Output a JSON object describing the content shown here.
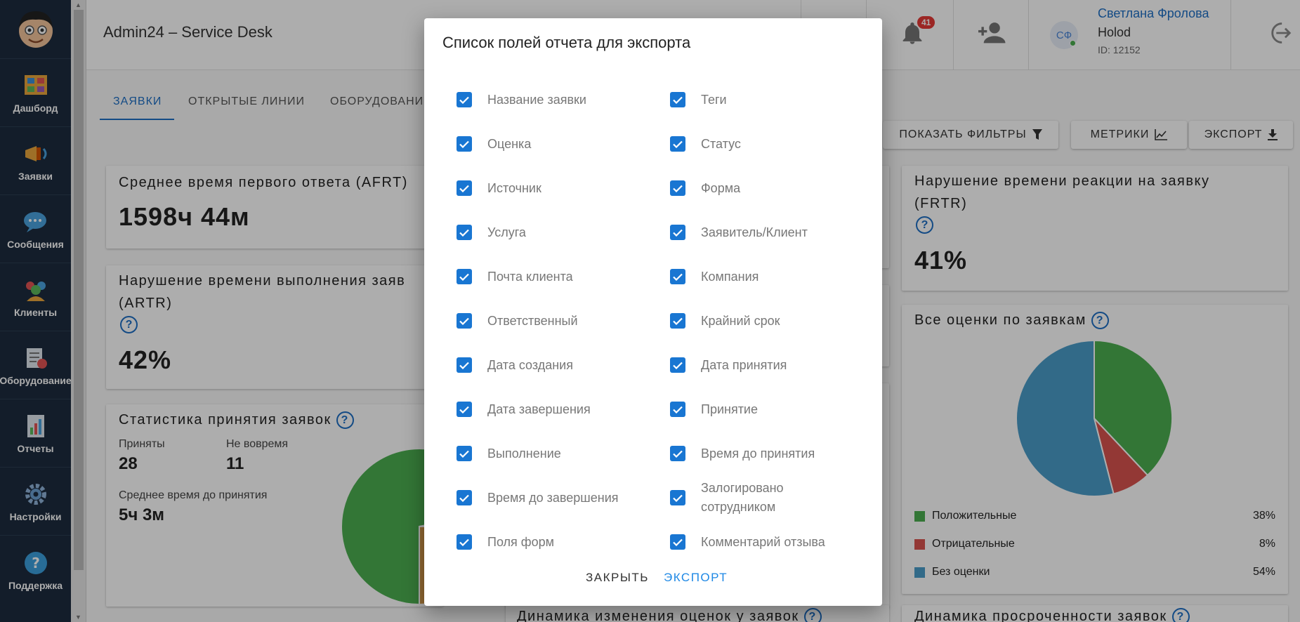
{
  "sidebar": {
    "items": [
      {
        "label": "Дашборд"
      },
      {
        "label": "Заявки"
      },
      {
        "label": "Сообщения"
      },
      {
        "label": "Клиенты"
      },
      {
        "label": "Оборудование"
      },
      {
        "label": "Отчеты"
      },
      {
        "label": "Настройки"
      },
      {
        "label": "Поддержка"
      }
    ]
  },
  "header": {
    "title": "Admin24 – Service Desk",
    "notifications_count": "41",
    "user": {
      "initials": "СФ",
      "name": "Светлана Фролова",
      "org": "Holod",
      "id": "ID: 12152"
    }
  },
  "tabs": [
    {
      "label": "ЗАЯВКИ"
    },
    {
      "label": "ОТКРЫТЫЕ ЛИНИИ"
    },
    {
      "label": "ОБОРУДОВАНИ"
    }
  ],
  "toolbar": {
    "filters_label": "ПОКАЗАТЬ ФИЛЬТРЫ",
    "metrics_label": "МЕТРИКИ",
    "export_label": "ЭКСПОРТ"
  },
  "cards": {
    "afrt": {
      "title": "Среднее время первого ответа (AFRT)",
      "value": "1598ч 44м"
    },
    "artr": {
      "title": "Нарушение времени выполнения заяв",
      "title2": "(ARTR)",
      "value": "42%"
    },
    "stats": {
      "title": "Статистика принятия заявок",
      "accepted_label": "Приняты",
      "accepted_value": "28",
      "late_label": "Не вовремя",
      "late_value": "11",
      "avg_label": "Среднее время до принятия",
      "avg_value": "5ч 3м"
    },
    "frtr": {
      "title": "Нарушение времени реакции на заявку",
      "title2": "(FRTR)",
      "value": "41%"
    },
    "ratings": {
      "title": "Все оценки по заявкам"
    },
    "dyn_ratings": {
      "title": "Динамика изменения оценок у заявок"
    },
    "dyn_overdue": {
      "title": "Динамика просроченности заявок"
    }
  },
  "chart_data": [
    {
      "type": "pie",
      "title": "Все оценки по заявкам",
      "categories": [
        "Положительные",
        "Отрицательные",
        "Без оценки"
      ],
      "values": [
        38,
        8,
        54
      ],
      "labels": [
        "38%",
        "8%",
        "54%"
      ],
      "colors": [
        "#4caf50",
        "#d9534f",
        "#4a9cc9"
      ]
    },
    {
      "type": "pie",
      "title": "Статистика принятия заявок",
      "categories": [
        "",
        "",
        ""
      ],
      "values": [
        72,
        3,
        25
      ],
      "colors": [
        "#4caf50",
        "#d9534f",
        "#d49a4a"
      ]
    }
  ],
  "dialog": {
    "title": "Список полей отчета для экспорта",
    "left_fields": [
      "Название заявки",
      "Оценка",
      "Источник",
      "Услуга",
      "Почта клиента",
      "Ответственный",
      "Дата создания",
      "Дата завершения",
      "Выполнение",
      "Время до завершения",
      "Поля форм"
    ],
    "right_fields": [
      "Теги",
      "Статус",
      "Форма",
      "Заявитель/Клиент",
      "Компания",
      "Крайний срок",
      "Дата принятия",
      "Принятие",
      "Время до принятия",
      "Залогировано сотрудником",
      "Комментарий отзыва"
    ],
    "close_label": "ЗАКРЫТЬ",
    "export_label": "ЭКСПОРТ"
  }
}
